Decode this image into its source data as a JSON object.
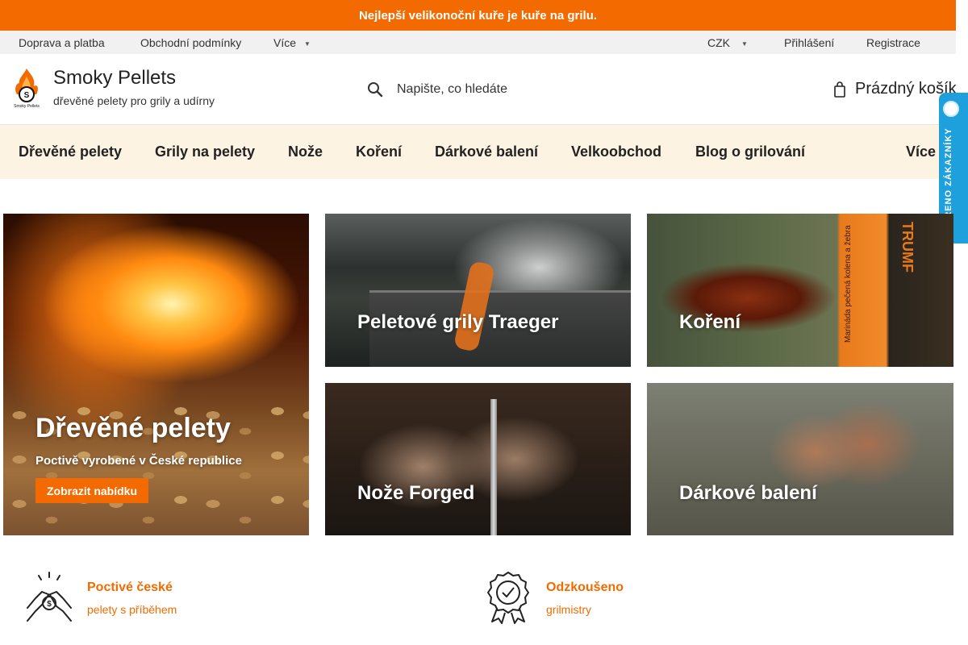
{
  "announcement": {
    "text": "Nejlepší velikonoční kuře je kuře na grilu."
  },
  "topbar": {
    "links": [
      "Doprava a platba",
      "Obchodní podmínky",
      "Více"
    ],
    "currency": "CZK",
    "login": "Přihlášení",
    "register": "Registrace"
  },
  "header": {
    "brand_name": "Smoky Pellets",
    "tagline": "dřevěné pelety pro grily a udírny",
    "logo_text": "Smoky Pellets",
    "search_placeholder": "Napište, co hledáte",
    "cart_label": "Prázdný košík"
  },
  "nav": {
    "items": [
      "Dřevěné pelety",
      "Grily na pelety",
      "Nože",
      "Koření",
      "Dárkové balení",
      "Velkoobchod",
      "Blog o grilování",
      "Více"
    ]
  },
  "badge": {
    "text": "OVĚŘENO ZÁKAZNÍKY"
  },
  "tiles": {
    "pellets": {
      "title": "Dřevěné pelety",
      "subtitle": "Poctivě vyrobené v České republice",
      "cta": "Zobrazit nabídku"
    },
    "traeger": {
      "title": "Peletové grily Traeger"
    },
    "koreni": {
      "title": "Koření",
      "packet_text": "Marináda pečená kolena a žebra",
      "brand": "TRUMF"
    },
    "noze": {
      "title": "Nože Forged"
    },
    "darkove": {
      "title": "Dárkové balení"
    }
  },
  "features": [
    {
      "title": "Poctivé české",
      "subtitle": "pelety s příběhem",
      "icon": "handshake-coin-icon"
    },
    {
      "title": "Odzkoušeno",
      "subtitle": "grilmistry",
      "icon": "award-ribbon-icon"
    }
  ],
  "colors": {
    "accent": "#f36b00",
    "nav_bg": "#fdf3e3",
    "topbar_bg": "#f1f1f1",
    "badge_bg": "#1ea0dc"
  }
}
